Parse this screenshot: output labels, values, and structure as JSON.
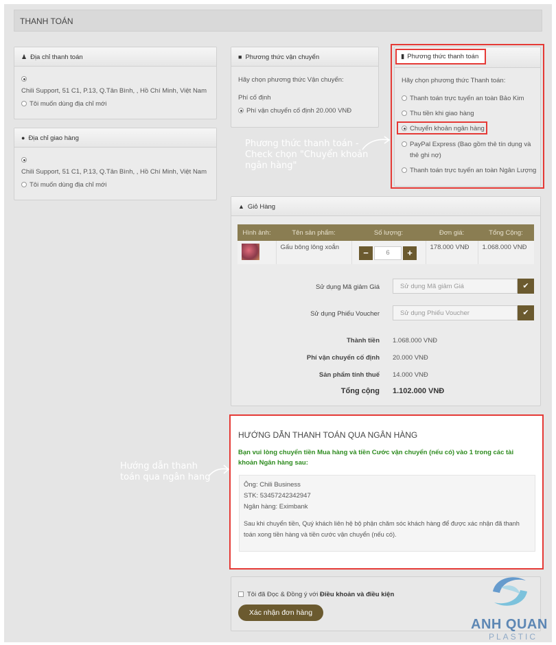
{
  "page_title": "THANH TOÁN",
  "billing": {
    "title": "Địa chỉ thanh toán",
    "address": "Chili Support, 51 C1, P.13, Q.Tân Bình, , Hồ Chí Minh, Việt Nam",
    "new_address": "Tôi muốn dùng địa chỉ mới"
  },
  "shipping_address": {
    "title": "Địa chỉ giao hàng",
    "address": "Chili Support, 51 C1, P.13, Q.Tân Bình, , Hồ Chí Minh, Việt Nam",
    "new_address": "Tôi muốn dùng địa chỉ mới"
  },
  "shipping_method": {
    "title": "Phương thức vận chuyển",
    "prompt": "Hãy chọn phương thức Vận chuyển:",
    "group": "Phí cố định",
    "option": "Phí vận chuyển cố định 20.000 VNĐ"
  },
  "payment_method": {
    "title": "Phương thức thanh toán",
    "prompt": "Hãy chọn phương thức Thanh toán:",
    "options": [
      "Thanh toán trực tuyến an toàn Bảo Kim",
      "Thu tiền khi giao hàng",
      "Chuyển khoản ngân hàng",
      "PayPal Express (Bao gồm thẻ tín dụng và",
      "thẻ ghi nợ)",
      "Thanh toán trực tuyến an toàn Ngân Lượng"
    ],
    "selected_index": 2
  },
  "annotations": {
    "payment_line1": "Phương thức thanh toán -",
    "payment_line2": "Check chọn \"Chuyển khoản",
    "payment_line3": "ngân hàng\"",
    "bank_line1": "Hướng dẫn thanh",
    "bank_line2": "toán qua ngân hang"
  },
  "cart": {
    "title": "Giỏ Hàng",
    "headers": [
      "Hình ảnh:",
      "Tên sản phẩm:",
      "Số lượng:",
      "Đơn giá:",
      "Tổng Cộng:"
    ],
    "item": {
      "name": "Gấu bông lông xoắn",
      "qty": "6",
      "unit_price": "178.000 VNĐ",
      "total": "1.068.000 VNĐ"
    },
    "coupon_label": "Sử dụng Mã giảm Giá",
    "coupon_placeholder": "Sử dụng Mã giảm Giá",
    "voucher_label": "Sử dụng Phiếu Voucher",
    "voucher_placeholder": "Sử dụng Phiếu Voucher",
    "totals": [
      {
        "label": "Thành tiền",
        "value": "1.068.000 VNĐ"
      },
      {
        "label": "Phí vận chuyển cố định",
        "value": "20.000 VNĐ"
      },
      {
        "label": "Sản phẩm tính thuế",
        "value": "14.000 VNĐ"
      },
      {
        "label": "Tổng cộng",
        "value": "1.102.000 VNĐ"
      }
    ]
  },
  "bank": {
    "title": "HƯỚNG DẪN THANH TOÁN QUA NGÂN HÀNG",
    "notice_line1": "Bạn vui lòng chuyển tiền Mua hàng và tiền Cước vận chuyển (nếu có) vào 1 trong các tài",
    "notice_line2": "khoản Ngân hàng sau:",
    "owner": "Ông: Chili Business",
    "account": "STK: 53457242342947",
    "bank_name": "Ngân hàng: Eximbank",
    "after_line1": "Sau khi chuyển tiền, Quý khách liên hệ bộ phận chăm sóc khách hàng để được xác nhận đã thanh",
    "after_line2": "toán xong tiền hàng và tiền cước vận chuyển (nếu có)."
  },
  "agree": {
    "prefix": "Tôi đã Đọc & Đồng ý với ",
    "terms": "Điều khoản và điều kiện",
    "submit": "Xác nhận đơn hàng"
  },
  "watermark": {
    "brand": "ANH QUAN",
    "sub": "PLASTIC"
  },
  "colors": {
    "accent": "#6b5a2f",
    "table_header": "#8a7d52",
    "highlight": "#e53935",
    "notice_green": "#2e8b1f"
  }
}
